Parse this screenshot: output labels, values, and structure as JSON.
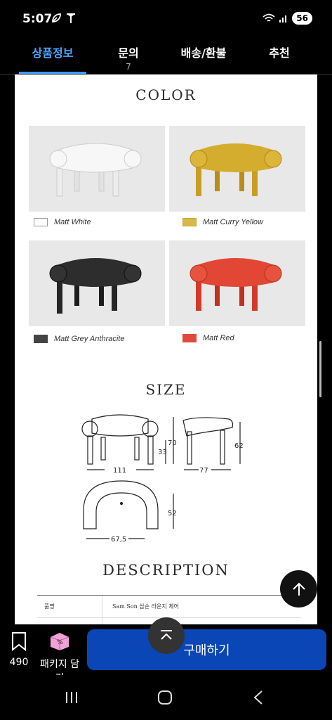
{
  "status": {
    "time": "5:07",
    "battery": "56"
  },
  "tabs": [
    {
      "label": "상품정보",
      "count": ""
    },
    {
      "label": "문의",
      "count": "7"
    },
    {
      "label": "배송/환불",
      "count": ""
    },
    {
      "label": "추천",
      "count": ""
    }
  ],
  "color_section": {
    "title": "COLOR",
    "items": [
      {
        "label": "Matt White",
        "color": "#ffffff",
        "chair": "#f2f2f2"
      },
      {
        "label": "Matt Curry Yellow",
        "color": "#d9b84a",
        "chair": "#d4ad2e"
      },
      {
        "label": "Matt Grey Anthracite",
        "color": "#444444",
        "chair": "#2b2b2b"
      },
      {
        "label": "Matt Red",
        "color": "#e04a3a",
        "chair": "#e24735"
      }
    ]
  },
  "size_section": {
    "title": "SIZE",
    "dims": {
      "width": "111",
      "height": "70",
      "seat": "33",
      "side_height": "62",
      "depth": "77",
      "top_depth": "52",
      "top_width": "67,5"
    }
  },
  "description_section": {
    "title": "DESCRIPTION",
    "rows": [
      {
        "key": "품명",
        "value": "Sam Son 삼손 라운지 체어"
      }
    ]
  },
  "bottom": {
    "wish_count": "490",
    "package_label": "패키지 담기",
    "buy_label": "구매하기"
  },
  "colors": {
    "accent": "#3b9cff",
    "buy_button": "#0a46b5"
  }
}
